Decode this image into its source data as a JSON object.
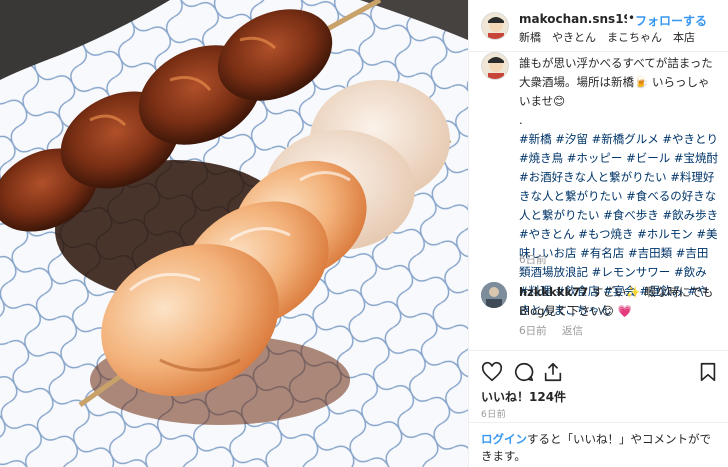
{
  "post": {
    "username": "makochan.sns196",
    "separator": "•",
    "follow_label": "フォローする",
    "location": "新橋　やきとん　まこちゃん　本店",
    "caption": "誰もが思い浮かべるすべてが詰まった大衆酒場。場所は新橋🍺 いらっしゃいませ😊",
    "caption_dot": ".",
    "hashtags": "#新橋 #汐留 #新橋グルメ #やきとり #焼き鳥 #ホッピー #ビール #宝焼酎 #お酒好きな人と繋がりたい #料理好きな人と繋がりたい #食べるの好きな人と繋がりたい #食べ歩き #飲み歩き #やきとん #もつ焼き #ホルモン #美味しいお店 #有名店 #吉田類 #吉田類酒場放浪記 #レモンサワー #飲み #料理 #飲食店 #宴会 #昼飲み #やきとんまこちゃん",
    "caption_time": "6日前"
  },
  "comment": {
    "username": "hzkkkkk77",
    "text": "すごい✨ 暇な時にでもBlog見て下さい😊 💗",
    "time": "6日前",
    "reply_label": "返信"
  },
  "actions": {
    "likes": "いいね！124件",
    "date": "6日前",
    "icons": [
      "heart-icon",
      "comment-icon",
      "share-icon",
      "bookmark-icon"
    ]
  },
  "login": {
    "link": "ログイン",
    "text": "すると「いいね！」やコメントができます。"
  },
  "colors": {
    "link": "#3897f0",
    "hashtag": "#003569",
    "muted": "#999999",
    "border": "#efefef"
  }
}
